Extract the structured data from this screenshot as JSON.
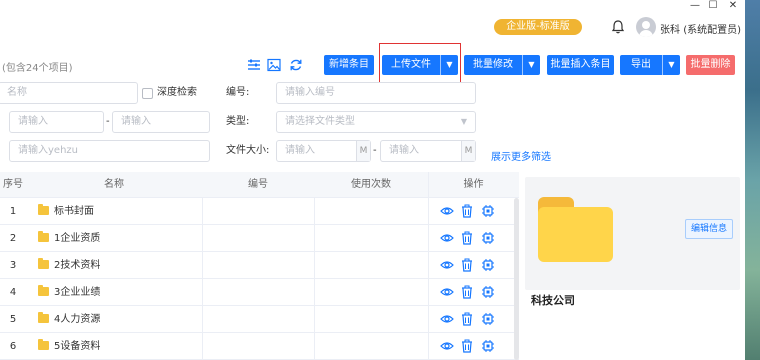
{
  "window": {
    "minimize": "—",
    "maximize": "☐",
    "close": "✕"
  },
  "header": {
    "edition": "企业版-标准版",
    "user_name": "张科",
    "user_role": "(系统配置员)"
  },
  "toolbar": {
    "item_count": "(包含24个项目)",
    "new_item": "新增条目",
    "upload_file": "上传文件",
    "batch_edit": "批量修改",
    "batch_insert": "批量插入条目",
    "export": "导出",
    "batch_delete": "批量删除"
  },
  "filters": {
    "name_placeholder": "名称",
    "deep_search": "深度检索",
    "code_label": "编号:",
    "code_placeholder": "请输入编号",
    "range_start_placeholder": "请输入",
    "range_end_placeholder": "请输入",
    "range_sep": "-",
    "type_label": "类型:",
    "type_placeholder": "请选择文件类型",
    "yehzu_placeholder": "请输入yehzu",
    "size_label": "文件大小:",
    "size_min_placeholder": "请输入",
    "size_max_placeholder": "请输入",
    "size_unit": "M",
    "size_sep": "-",
    "more_filters": "展示更多筛选"
  },
  "table": {
    "headers": {
      "index": "序号",
      "name": "名称",
      "code": "编号",
      "usage": "使用次数",
      "ops": "操作"
    },
    "rows": [
      {
        "index": "1",
        "name": "标书封面"
      },
      {
        "index": "2",
        "name": "1企业资质"
      },
      {
        "index": "3",
        "name": "2技术资料"
      },
      {
        "index": "4",
        "name": "3企业业绩"
      },
      {
        "index": "5",
        "name": "4人力资源"
      },
      {
        "index": "6",
        "name": "5设备资料"
      }
    ]
  },
  "preview": {
    "edit_info": "编辑信息",
    "company": "科技公司"
  },
  "colors": {
    "primary": "#1677ff",
    "danger": "#f56c6c",
    "edition": "#f0b432",
    "folder": "#ffd54a",
    "highlight_frame": "#e03333"
  }
}
